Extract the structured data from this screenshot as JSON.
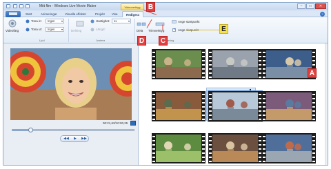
{
  "window": {
    "title": "Mitt film - Windows Live Movie Maker",
    "context_group": "Videoverktyg",
    "minimize": "–",
    "maximize": "□",
    "close": "✕"
  },
  "tabs": [
    "Start",
    "Animeringar",
    "Visuella effekter",
    "Projekt",
    "Visa",
    "Redigera"
  ],
  "help": "?",
  "ribbon": {
    "videofarg_label": "Videofärg",
    "tona_in_label": "Tona in:",
    "tona_in_value": "Ingen",
    "tona_ut_label": "Tona ut:",
    "tona_ut_value": "Ingen",
    "group_ljud": "Ljud",
    "dela_label": "Delning",
    "hastighet_label": "Hastighet:",
    "hastighet_value": "1x",
    "langd_label": "Längd:",
    "group_justera": "Justera",
    "dela2_label": "Dela",
    "trimverktyg_label": "Trimverktyg",
    "ange_start_label": "Ange startpunkt",
    "ange_slut_label": "Ange slutpunkt",
    "group_redigering": "Redigering"
  },
  "player": {
    "time": "00:21,63/10:00,25",
    "prev_glyph": "◀◀",
    "play_glyph": "▶",
    "next_glyph": "▶▶",
    "position_fraction": 0.15
  },
  "annotations": {
    "A": "A",
    "B": "B",
    "C": "C",
    "D": "D",
    "E": "E"
  },
  "colors": {
    "callout_red": "#e0403f",
    "callout_yellow": "#f6e14a",
    "accent": "#2b63b3"
  }
}
